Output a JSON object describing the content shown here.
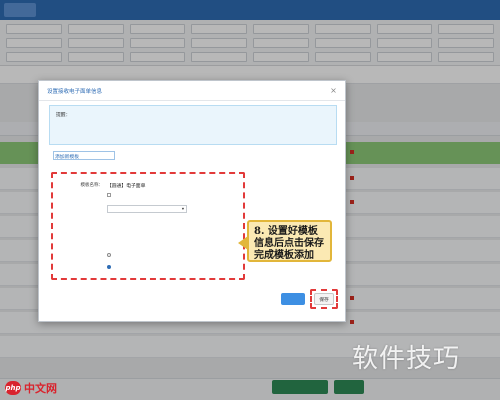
{
  "topnav": {
    "tabs": [
      "",
      "",
      "",
      "",
      "",
      "",
      "",
      "",
      "",
      "",
      ""
    ],
    "active_index": 0
  },
  "filters": {
    "row1": [
      "",
      "",
      "",
      "",
      "",
      "",
      "",
      ""
    ],
    "row2": [
      "",
      "",
      "",
      "",
      "",
      "",
      "",
      ""
    ],
    "row3": [
      "",
      "",
      "",
      "",
      "",
      "",
      "",
      ""
    ]
  },
  "modal": {
    "title": "设置接收电子面单信息",
    "close_glyph": "×",
    "notice_label": "提醒：",
    "notice_lines": [
      "",
      "",
      ""
    ],
    "add_link": "添加新模板",
    "form": {
      "row1_label": "模板名称：",
      "row1_value": "【圆通】电子面单",
      "row1_check": "",
      "row2_label": "",
      "row2_select": "",
      "row3_label": "",
      "row3_hint": "",
      "row4_label": "",
      "row4_hint": "",
      "radio1": "",
      "radio2": ""
    },
    "submit_label": "",
    "save_label": "保存"
  },
  "callout": {
    "text": "8. 设置好模板信息后点击保存完成模板添加"
  },
  "bottombar": {
    "btn1": "",
    "btn2": ""
  },
  "watermarks": {
    "right": "软件技巧",
    "left_logo": "php",
    "left_text": "中文网"
  },
  "colors": {
    "nav": "#2f6db5",
    "highlight_row": "#8ecb79",
    "dashed_red": "#e23a3a",
    "callout_bg": "#fbe9b3",
    "primary_button": "#3d8fe3"
  }
}
